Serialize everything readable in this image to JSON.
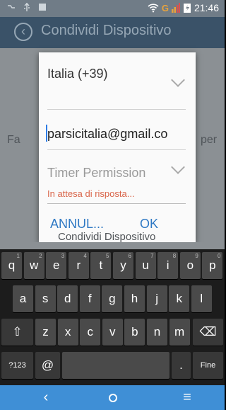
{
  "status_bar": {
    "network": "G",
    "time": "21:46"
  },
  "app": {
    "title": "Condividi Dispositivo",
    "bg_left": "Fa",
    "bg_right": "per"
  },
  "dialog": {
    "country": "Italia (+39)",
    "email": "parsicitalia@gmail.co",
    "timer": "Timer Permission",
    "status": "In attesa di risposta...",
    "cancel": "ANNUL...",
    "ok": "OK"
  },
  "keyboard": {
    "suggestion": "Condividi Dispositivo",
    "row1": [
      {
        "k": "q",
        "n": "1"
      },
      {
        "k": "w",
        "n": "2"
      },
      {
        "k": "e",
        "n": "3"
      },
      {
        "k": "r",
        "n": "4"
      },
      {
        "k": "t",
        "n": "5"
      },
      {
        "k": "y",
        "n": "6"
      },
      {
        "k": "u",
        "n": "7"
      },
      {
        "k": "i",
        "n": "8"
      },
      {
        "k": "o",
        "n": "9"
      },
      {
        "k": "p",
        "n": "0"
      }
    ],
    "row2": [
      "a",
      "s",
      "d",
      "f",
      "g",
      "h",
      "j",
      "k",
      "l"
    ],
    "row3": [
      "z",
      "x",
      "c",
      "v",
      "b",
      "n",
      "m"
    ],
    "shift": "⇧",
    "backspace": "⌫",
    "sym": "?123",
    "at": "@",
    "dot": ".",
    "done": "Fine"
  },
  "nav": {
    "back": "‹",
    "menu": "≡"
  }
}
